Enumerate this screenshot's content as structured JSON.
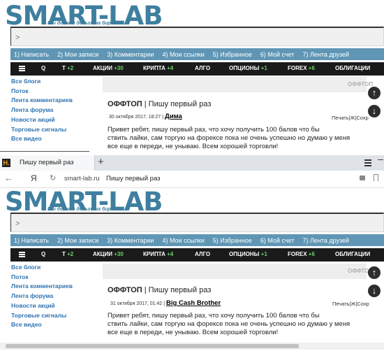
{
  "top": {
    "logo": "SMART-LAB",
    "slogan": "Мы делаем деньги на бирже",
    "search_prompt": ">",
    "menu1": [
      "1) Написать",
      "2) Мои записи",
      "3) Комментарии",
      "4) Мои ссылки",
      "5) Избранное",
      "6) Мой счет",
      "7) Лента друзей"
    ],
    "menu2": {
      "q": "Q",
      "t": {
        "label": "T",
        "count": "+2"
      },
      "akcii": {
        "label": "АКЦИИ",
        "count": "+30"
      },
      "kripta": {
        "label": "КРИПТА",
        "count": "+4"
      },
      "algo": "АЛГО",
      "opciony": {
        "label": "ОПЦИОНЫ",
        "count": "+1"
      },
      "forex": {
        "label": "FOREX",
        "count": "+6"
      },
      "obligacii": "ОБЛИГАЦИИ"
    },
    "sidebar": [
      "Все блоги",
      "Поток",
      "Лента комментариев",
      "Лента форума",
      "Новости акций",
      "Торговые сигналы",
      "Все видео"
    ],
    "offtop_label": "ОФФТОП",
    "post": {
      "category": "ОФФТОП",
      "separator": "|",
      "title": "Пишу первый раз",
      "date": "30 октября 2017, 18:27",
      "author": "Дима",
      "actions": "Печать|Ж|Сохр",
      "text": [
        "Привет ребят, пишу первый раз, что хочу получить 100 балов что бы",
        "ствить лайки, сам торгую на форексе пока не очень успешно но думаю у меня",
        "все еще в переди, не унываю. Всем хорошей торговли!"
      ]
    }
  },
  "browser": {
    "tab_title": "Пишу первый раз",
    "new_tab": "+",
    "nav_letter": "Я",
    "url_domain": "smart-lab.ru",
    "url_title": "Пишу первый раз"
  },
  "bottom": {
    "logo": "SMART-LAB",
    "slogan": "Мы делаем деньги на бирже",
    "search_prompt": ">",
    "menu1": [
      "1) Написать",
      "2) Мои записи",
      "3) Комментарии",
      "4) Мои ссылки",
      "5) Избранное",
      "6) Мой счет",
      "7) Лента друзей"
    ],
    "menu2": {
      "q": "Q",
      "t": {
        "label": "T",
        "count": "+2"
      },
      "akcii": {
        "label": "АКЦИИ",
        "count": "+30"
      },
      "kripta": {
        "label": "КРИПТА",
        "count": "+4"
      },
      "algo": "АЛГО",
      "opciony": {
        "label": "ОПЦИОНЫ",
        "count": "+1"
      },
      "forex": {
        "label": "FOREX",
        "count": "+6"
      },
      "obligacii": "ОБЛИГАЦИИ"
    },
    "sidebar": [
      "Все блоги",
      "Поток",
      "Лента комментариев",
      "Лента форума",
      "Новости акций",
      "Торговые сигналы",
      "Все видео"
    ],
    "offtop_label": "ОФФТОП",
    "post": {
      "category": "ОФФТОП",
      "separator": "|",
      "title": "Пишу первый раз",
      "date": "31 октября 2017, 01:42",
      "author": "Big Cash Brother",
      "actions": "Печать|Ж|Сохр",
      "text": [
        "Привет ребят, пишу первый раз, что хочу получить 100 балов что бы",
        "ствить лайки, сам торгую на форексе пока не очень успешно но думаю у меня",
        "все еще в переди, не унываю. Всем хорошей торговли!"
      ]
    }
  },
  "icons": {
    "scroll_up": "arrow-up-icon",
    "scroll_down": "arrow-down-icon",
    "menu": "hamburger-icon",
    "back": "arrow-left-icon",
    "reload": "reload-icon",
    "lock": "lock-icon",
    "bookmark": "bookmark-icon",
    "site_favicon": "smartlab-favicon-icon"
  },
  "colors": {
    "brand": "#3e7fa0",
    "menu1_bg": "#5f96b5",
    "menu2_bg": "#1a1a1a",
    "count_green": "#6ad06a",
    "link": "#2f73b0"
  }
}
